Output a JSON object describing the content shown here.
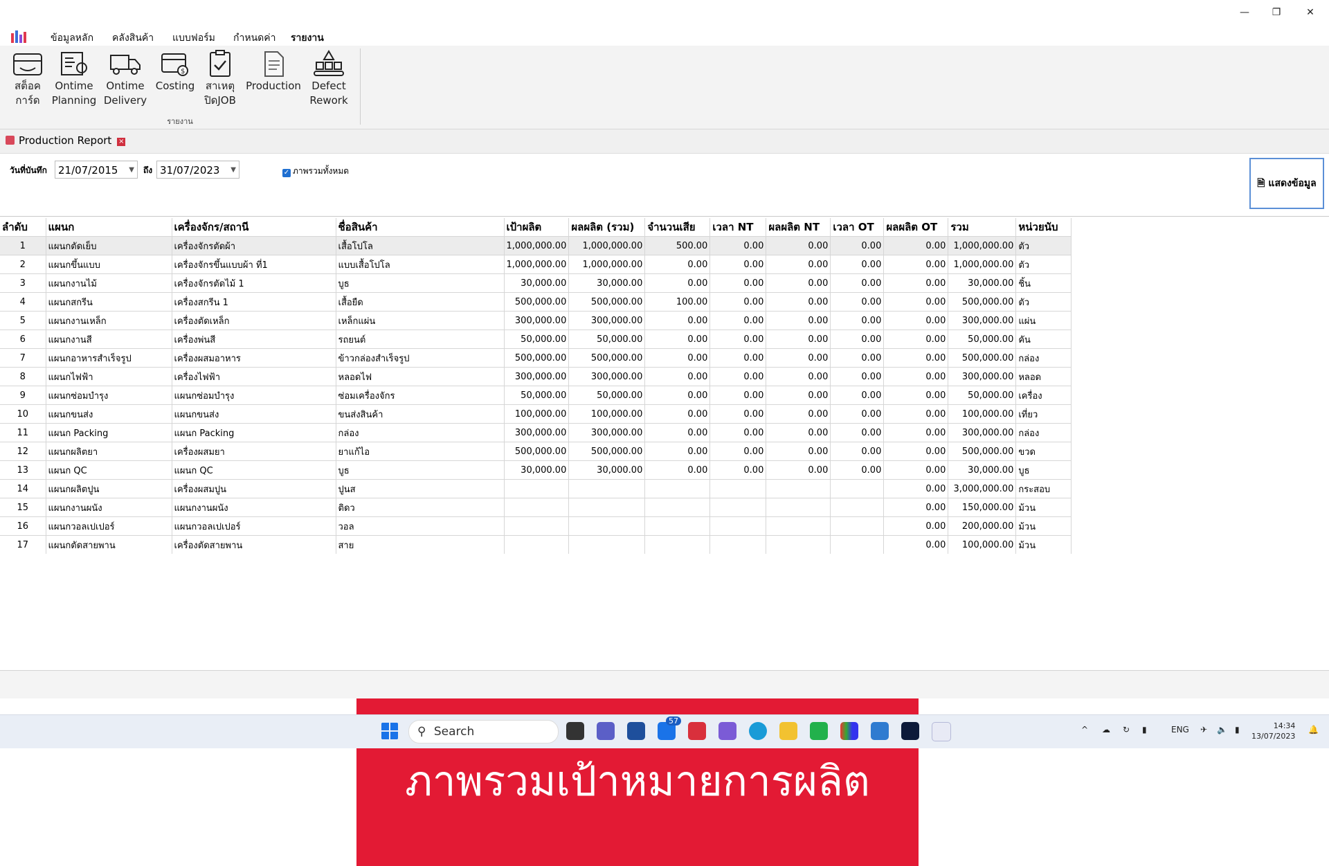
{
  "window": {
    "minimize": "—",
    "maximize": "❐",
    "close": "✕"
  },
  "menu": [
    "ข้อมูลหลัก",
    "คลังสินค้า",
    "แบบฟอร์ม",
    "กำหนดค่า",
    "รายงาน"
  ],
  "ribbon": {
    "buttons": [
      {
        "line1": "สต็อค",
        "line2": "การ์ด"
      },
      {
        "line1": "Ontime",
        "line2": "Planning"
      },
      {
        "line1": "Ontime",
        "line2": "Delivery"
      },
      {
        "line1": "Costing",
        "line2": ""
      },
      {
        "line1": "สาเหตุ",
        "line2": "ปิดJOB"
      },
      {
        "line1": "Production",
        "line2": ""
      },
      {
        "line1": "Defect",
        "line2": "Rework"
      }
    ],
    "group_label": "รายงาน"
  },
  "tab": {
    "title": "Production Report",
    "close": "×"
  },
  "filter": {
    "date_label": "วันที่บันทึก",
    "from": "21/07/2015",
    "to_label": "ถึง",
    "to": "31/07/2023",
    "checkbox_label": "ภาพรวมทั้งหมด",
    "show_button": "แสดงข้อมูล"
  },
  "grid": {
    "columns": [
      "ลำดับ",
      "แผนก",
      "เครื่องจักร/สถานี",
      "ชื่อสินค้า",
      "เป้าผลิต",
      "ผลผลิต (รวม)",
      "จำนวนเสีย",
      "เวลา NT",
      "ผลผลิต NT",
      "เวลา OT",
      "ผลผลิต OT",
      "รวม",
      "หน่วยนับ"
    ],
    "rows": [
      [
        "1",
        "แผนกตัดเย็บ",
        "เครื่องจักรตัดผ้า",
        "เสื้อโปโล",
        "1,000,000.00",
        "1,000,000.00",
        "500.00",
        "0.00",
        "0.00",
        "0.00",
        "0.00",
        "1,000,000.00",
        "ตัว"
      ],
      [
        "2",
        "แผนกขึ้นแบบ",
        "เครื่องจักรขึ้นแบบผ้า ที่1",
        "แบบเสื้อโปโล",
        "1,000,000.00",
        "1,000,000.00",
        "0.00",
        "0.00",
        "0.00",
        "0.00",
        "0.00",
        "1,000,000.00",
        "ตัว"
      ],
      [
        "3",
        "แผนกงานไม้",
        "เครื่องจักรตัดไม้ 1",
        "บูธ",
        "30,000.00",
        "30,000.00",
        "0.00",
        "0.00",
        "0.00",
        "0.00",
        "0.00",
        "30,000.00",
        "ชิ้น"
      ],
      [
        "4",
        "แผนกสกรีน",
        "เครื่องสกรีน 1",
        "เสื้อยืด",
        "500,000.00",
        "500,000.00",
        "100.00",
        "0.00",
        "0.00",
        "0.00",
        "0.00",
        "500,000.00",
        "ตัว"
      ],
      [
        "5",
        "แผนกงานเหล็ก",
        "เครื่องตัดเหล็ก",
        "เหล็กแผ่น",
        "300,000.00",
        "300,000.00",
        "0.00",
        "0.00",
        "0.00",
        "0.00",
        "0.00",
        "300,000.00",
        "แผ่น"
      ],
      [
        "6",
        "แผนกงานสี",
        "เครื่องพ่นสี",
        "รถยนต์",
        "50,000.00",
        "50,000.00",
        "0.00",
        "0.00",
        "0.00",
        "0.00",
        "0.00",
        "50,000.00",
        "คัน"
      ],
      [
        "7",
        "แผนกอาหารสำเร็จรูป",
        "เครื่องผสมอาหาร",
        "ข้าวกล่องสำเร็จรูป",
        "500,000.00",
        "500,000.00",
        "0.00",
        "0.00",
        "0.00",
        "0.00",
        "0.00",
        "500,000.00",
        "กล่อง"
      ],
      [
        "8",
        "แผนกไฟฟ้า",
        "เครื่องไฟฟ้า",
        "หลอดไฟ",
        "300,000.00",
        "300,000.00",
        "0.00",
        "0.00",
        "0.00",
        "0.00",
        "0.00",
        "300,000.00",
        "หลอด"
      ],
      [
        "9",
        "แผนกซ่อมบำรุง",
        "แผนกซ่อมบำรุง",
        "ซ่อมเครื่องจักร",
        "50,000.00",
        "50,000.00",
        "0.00",
        "0.00",
        "0.00",
        "0.00",
        "0.00",
        "50,000.00",
        "เครื่อง"
      ],
      [
        "10",
        "แผนกขนส่ง",
        "แผนกขนส่ง",
        "ขนส่งสินค้า",
        "100,000.00",
        "100,000.00",
        "0.00",
        "0.00",
        "0.00",
        "0.00",
        "0.00",
        "100,000.00",
        "เที่ยว"
      ],
      [
        "11",
        "แผนก Packing",
        "แผนก Packing",
        "กล่อง",
        "300,000.00",
        "300,000.00",
        "0.00",
        "0.00",
        "0.00",
        "0.00",
        "0.00",
        "300,000.00",
        "กล่อง"
      ],
      [
        "12",
        "แผนกผลิตยา",
        "เครื่องผสมยา",
        "ยาแก้ไอ",
        "500,000.00",
        "500,000.00",
        "0.00",
        "0.00",
        "0.00",
        "0.00",
        "0.00",
        "500,000.00",
        "ขวด"
      ],
      [
        "13",
        "แผนก QC",
        "แผนก QC",
        "บูธ",
        "30,000.00",
        "30,000.00",
        "0.00",
        "0.00",
        "0.00",
        "0.00",
        "0.00",
        "30,000.00",
        "บูธ"
      ],
      [
        "14",
        "แผนกผลิตปูน",
        "เครื่องผสมปูน",
        "ปูนส",
        "",
        "",
        "",
        "",
        "",
        "",
        "0.00",
        "3,000,000.00",
        "กระสอบ"
      ],
      [
        "15",
        "แผนกงานผนัง",
        "แผนกงานผนัง",
        "ติดว",
        "",
        "",
        "",
        "",
        "",
        "",
        "0.00",
        "150,000.00",
        "ม้วน"
      ],
      [
        "16",
        "แผนกวอลเปเปอร์",
        "แผนกวอลเปเปอร์",
        "วอล",
        "",
        "",
        "",
        "",
        "",
        "",
        "0.00",
        "200,000.00",
        "ม้วน"
      ],
      [
        "17",
        "แผนกตัดสายพาน",
        "เครื่องตัดสายพาน",
        "สาย",
        "",
        "",
        "",
        "",
        "",
        "",
        "0.00",
        "100,000.00",
        "ม้วน"
      ]
    ]
  },
  "banner": "ภาพรวมเป้าหมายการผลิต",
  "taskbar": {
    "search": "Search",
    "mail_badge": "57",
    "lang": "ENG",
    "time": "14:34",
    "date": "13/07/2023"
  }
}
